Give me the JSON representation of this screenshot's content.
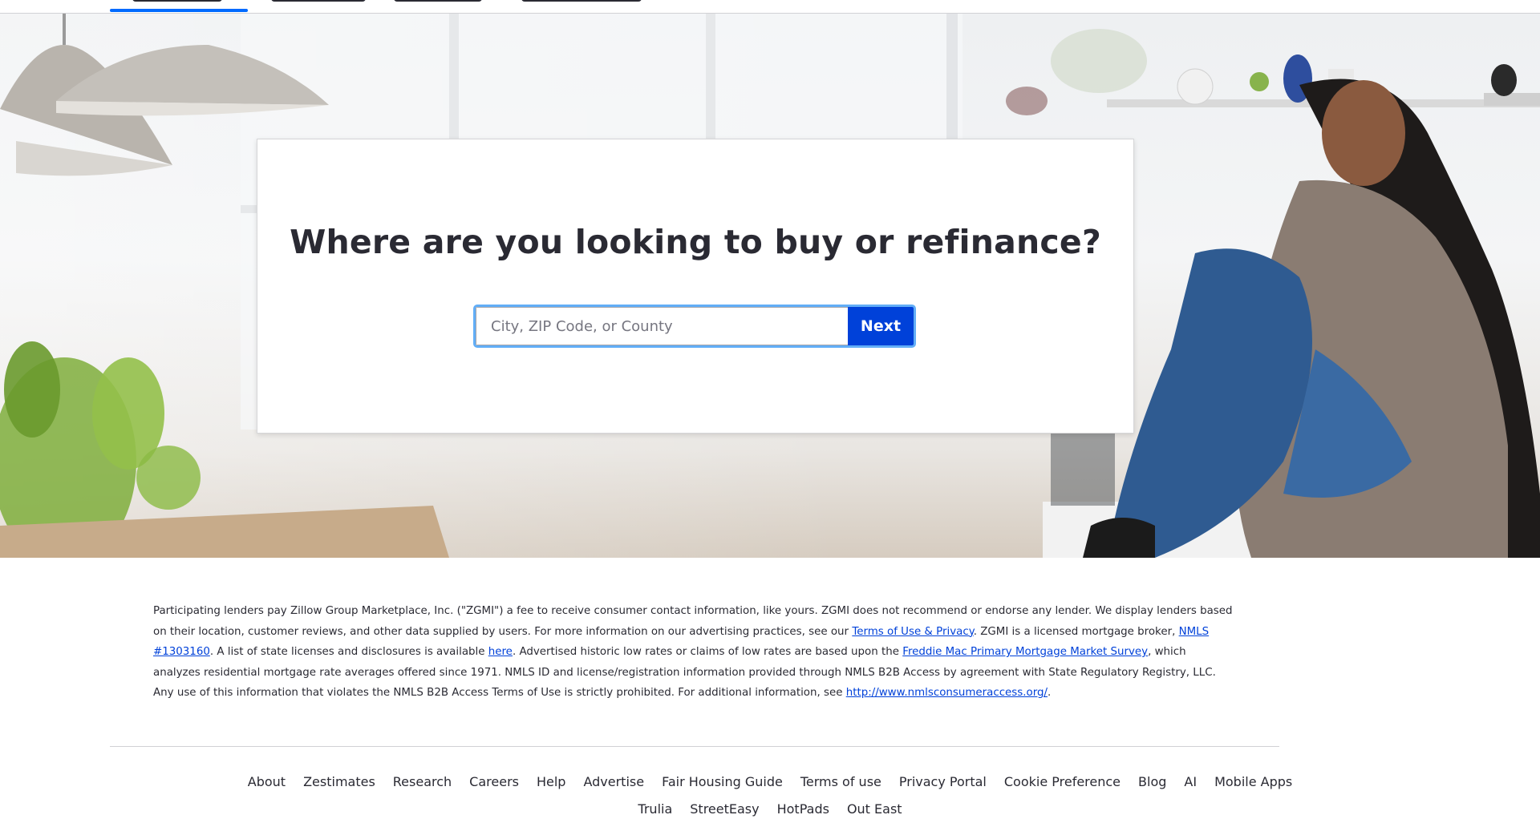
{
  "hero": {
    "title": "Where are you looking to buy or refinance?",
    "search_placeholder": "City, ZIP Code, or County",
    "next_label": "Next"
  },
  "disclaimer": {
    "part1": "Participating lenders pay Zillow Group Marketplace, Inc. (\"ZGMI\") a fee to receive consumer contact information, like yours. ZGMI does not recommend or endorse any lender. We display lenders based on their location, customer reviews, and other data supplied by users. For more information on our advertising practices, see our ",
    "link_terms": "Terms of Use & Privacy",
    "part2": ". ZGMI is a licensed mortgage broker, ",
    "link_nmls": "NMLS #1303160",
    "part3": ". A list of state licenses and disclosures is available ",
    "link_here": "here",
    "part4": ". Advertised historic low rates or claims of low rates are based upon the ",
    "link_freddie": "Freddie Mac Primary Mortgage Market Survey",
    "part5": ", which analyzes residential mortgage rate averages offered since 1971. NMLS ID and license/registration information provided through NMLS B2B Access by agreement with State Regulatory Registry, LLC. Any use of this information that violates the NMLS B2B Access Terms of Use is strictly prohibited. For additional information, see ",
    "link_nmls_url": "http://www.nmlsconsumeraccess.org/",
    "part6": "."
  },
  "footer": {
    "row1": [
      "About",
      "Zestimates",
      "Research",
      "Careers",
      "Help",
      "Advertise",
      "Fair Housing Guide",
      "Terms of use",
      "Privacy Portal",
      "Cookie Preference",
      "Blog",
      "AI",
      "Mobile Apps"
    ],
    "row2": [
      "Trulia",
      "StreetEasy",
      "HotPads",
      "Out East"
    ]
  },
  "colors": {
    "primary_button": "#0041d9",
    "active_tab": "#006aff",
    "focus_ring": "#62aef7",
    "link": "#0041d9"
  }
}
